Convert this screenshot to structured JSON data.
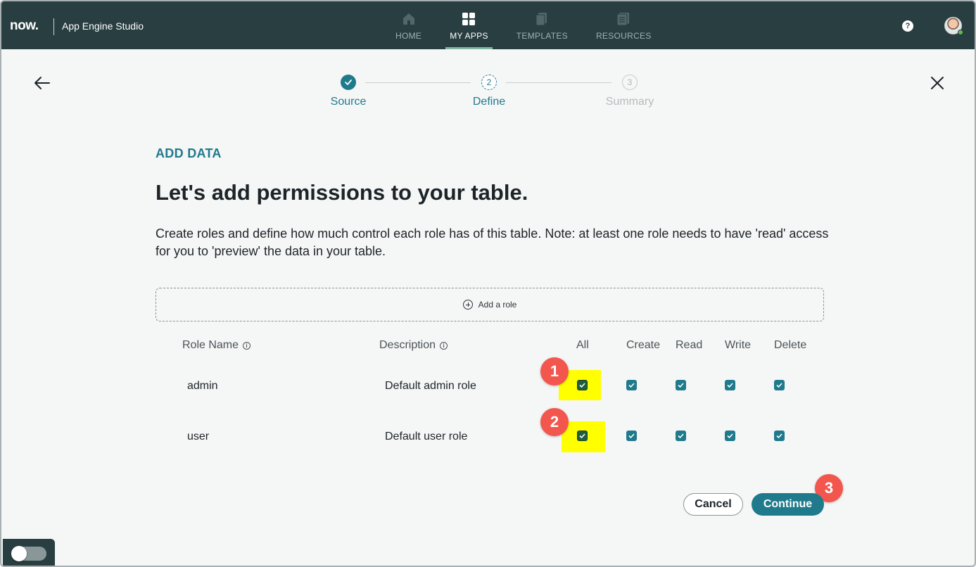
{
  "topbar": {
    "logo": "now.",
    "app_name": "App Engine Studio",
    "nav": [
      {
        "label": "HOME",
        "icon": "home-icon",
        "active": false
      },
      {
        "label": "MY APPS",
        "icon": "grid-icon",
        "active": true
      },
      {
        "label": "TEMPLATES",
        "icon": "templates-icon",
        "active": false
      },
      {
        "label": "RESOURCES",
        "icon": "resources-icon",
        "active": false
      }
    ],
    "help_icon": "?"
  },
  "wizard": {
    "steps": [
      {
        "number": "1",
        "label": "Source",
        "state": "complete"
      },
      {
        "number": "2",
        "label": "Define",
        "state": "current"
      },
      {
        "number": "3",
        "label": "Summary",
        "state": "pending"
      }
    ]
  },
  "content": {
    "eyebrow": "ADD DATA",
    "heading": "Let's add permissions to your table.",
    "description": "Create roles and define how much control each role has of this table. Note: at least one role needs to have 'read' access for you to 'preview' the data in your table.",
    "add_role_label": "Add a role"
  },
  "table": {
    "headers": {
      "role_name": "Role Name",
      "description": "Description",
      "all": "All",
      "create": "Create",
      "read": "Read",
      "write": "Write",
      "delete": "Delete"
    },
    "rows": [
      {
        "role": "admin",
        "description": "Default admin role",
        "all": true,
        "create": true,
        "read": true,
        "write": true,
        "delete": true
      },
      {
        "role": "user",
        "description": "Default user role",
        "all": true,
        "create": true,
        "read": true,
        "write": true,
        "delete": true
      }
    ]
  },
  "annotations": [
    "1",
    "2",
    "3"
  ],
  "actions": {
    "cancel": "Cancel",
    "continue": "Continue"
  },
  "colors": {
    "topbar": "#293e40",
    "accent": "#1f7a8c",
    "highlight": "#ffff00",
    "badge": "#f2564d"
  }
}
